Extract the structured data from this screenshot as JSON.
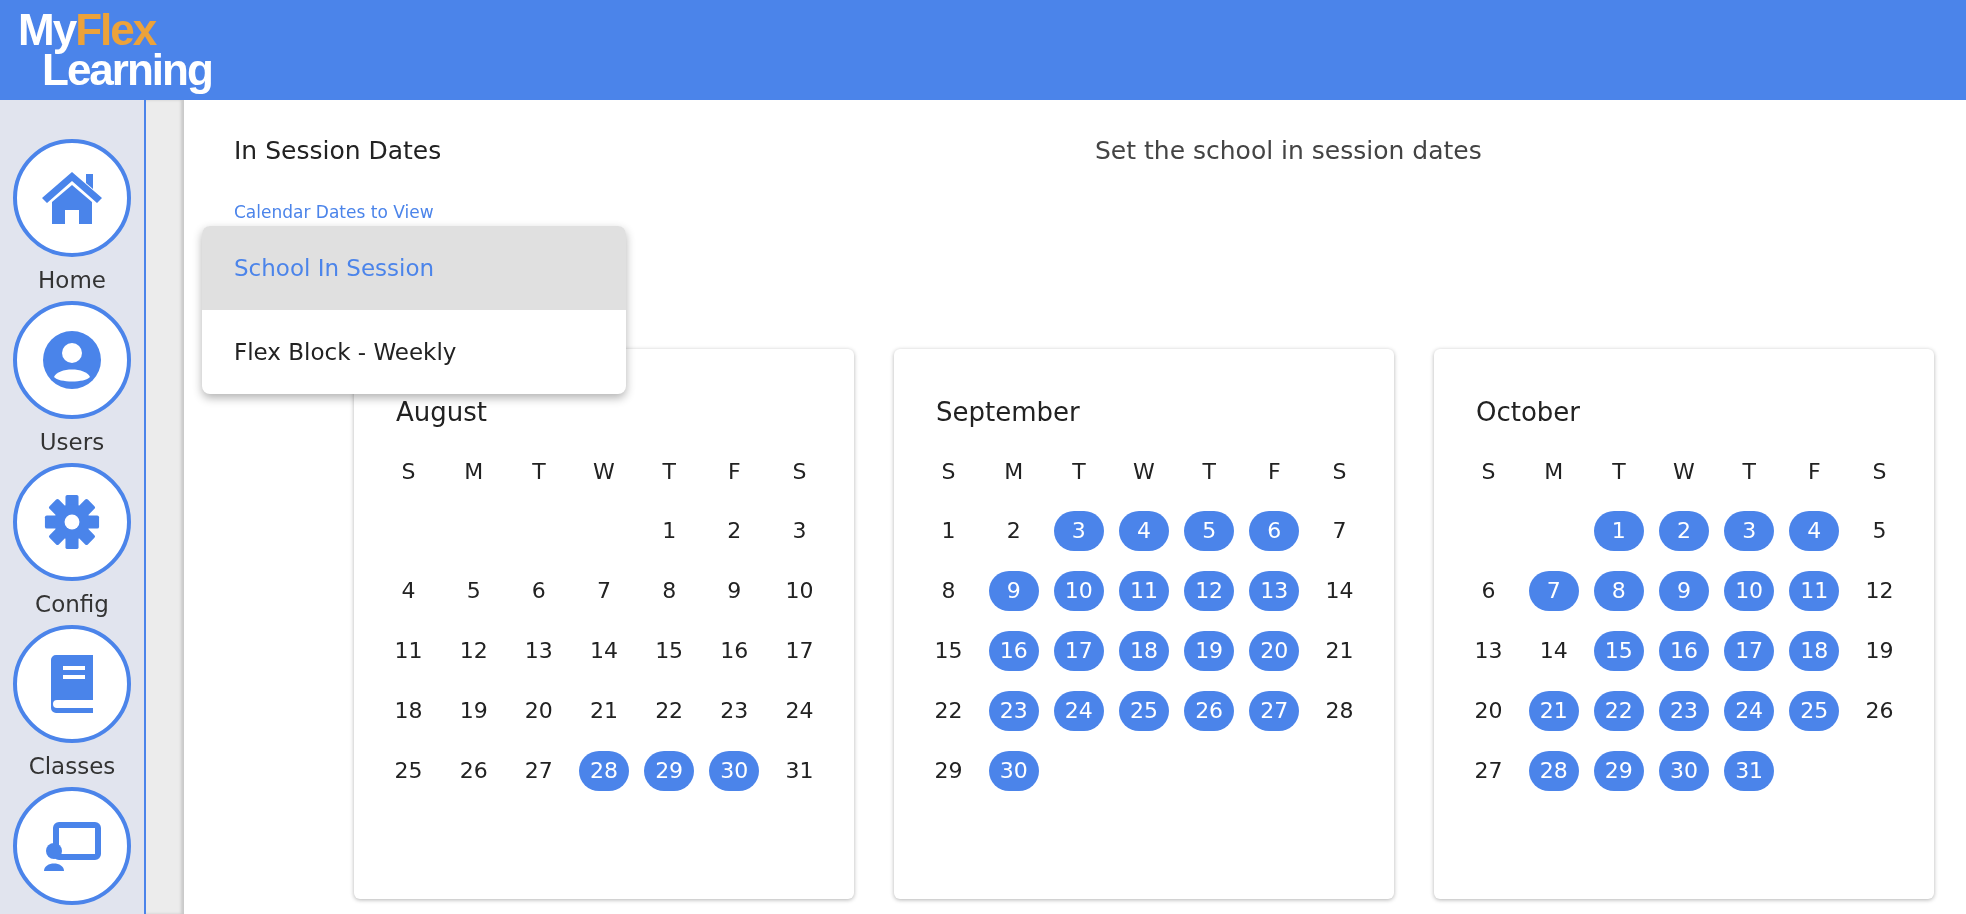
{
  "header": {
    "logo": {
      "top_left": "My",
      "top_right": "Flex",
      "bottom": "Learning"
    }
  },
  "sidebar": {
    "items": [
      {
        "label": "Home"
      },
      {
        "label": "Users"
      },
      {
        "label": "Config"
      },
      {
        "label": "Classes"
      }
    ]
  },
  "page": {
    "title": "In Session Dates",
    "subtitle": "Set the school in session dates"
  },
  "field": {
    "label": "Calendar Dates to View"
  },
  "menu": {
    "options": [
      {
        "label": "School In Session",
        "selected": true
      },
      {
        "label": "Flex Block - Weekly",
        "selected": false
      }
    ]
  },
  "calendars": [
    {
      "month": "August",
      "weekdays": [
        "S",
        "M",
        "T",
        "W",
        "T",
        "F",
        "S"
      ],
      "weeks": [
        [
          {
            "day": "1",
            "selected": false
          },
          {
            "day": "2",
            "selected": false
          },
          {
            "day": "3",
            "selected": false
          }
        ],
        [
          {
            "day": "4",
            "selected": false
          },
          {
            "day": "5",
            "selected": false
          },
          {
            "day": "6",
            "selected": false
          },
          {
            "day": "7",
            "selected": false
          },
          {
            "day": "8",
            "selected": false
          },
          {
            "day": "9",
            "selected": false
          },
          {
            "day": "10",
            "selected": false
          }
        ],
        [
          {
            "day": "11",
            "selected": false
          },
          {
            "day": "12",
            "selected": false
          },
          {
            "day": "13",
            "selected": false
          },
          {
            "day": "14",
            "selected": false
          },
          {
            "day": "15",
            "selected": false
          },
          {
            "day": "16",
            "selected": false
          },
          {
            "day": "17",
            "selected": false
          }
        ],
        [
          {
            "day": "18",
            "selected": false
          },
          {
            "day": "19",
            "selected": false
          },
          {
            "day": "20",
            "selected": false
          },
          {
            "day": "21",
            "selected": false
          },
          {
            "day": "22",
            "selected": false
          },
          {
            "day": "23",
            "selected": false
          },
          {
            "day": "24",
            "selected": false
          }
        ],
        [
          {
            "day": "25",
            "selected": false
          },
          {
            "day": "26",
            "selected": false
          },
          {
            "day": "27",
            "selected": false
          },
          {
            "day": "28",
            "selected": true
          },
          {
            "day": "29",
            "selected": true
          },
          {
            "day": "30",
            "selected": true
          },
          {
            "day": "31",
            "selected": false
          }
        ]
      ]
    },
    {
      "month": "September",
      "weekdays": [
        "S",
        "M",
        "T",
        "W",
        "T",
        "F",
        "S"
      ],
      "weeks": [
        [
          {
            "day": "1",
            "selected": false
          },
          {
            "day": "2",
            "selected": false
          },
          {
            "day": "3",
            "selected": true
          },
          {
            "day": "4",
            "selected": true
          },
          {
            "day": "5",
            "selected": true
          },
          {
            "day": "6",
            "selected": true
          },
          {
            "day": "7",
            "selected": false
          }
        ],
        [
          {
            "day": "8",
            "selected": false
          },
          {
            "day": "9",
            "selected": true
          },
          {
            "day": "10",
            "selected": true
          },
          {
            "day": "11",
            "selected": true
          },
          {
            "day": "12",
            "selected": true
          },
          {
            "day": "13",
            "selected": true
          },
          {
            "day": "14",
            "selected": false
          }
        ],
        [
          {
            "day": "15",
            "selected": false
          },
          {
            "day": "16",
            "selected": true
          },
          {
            "day": "17",
            "selected": true
          },
          {
            "day": "18",
            "selected": true
          },
          {
            "day": "19",
            "selected": true
          },
          {
            "day": "20",
            "selected": true
          },
          {
            "day": "21",
            "selected": false
          }
        ],
        [
          {
            "day": "22",
            "selected": false
          },
          {
            "day": "23",
            "selected": true
          },
          {
            "day": "24",
            "selected": true
          },
          {
            "day": "25",
            "selected": true
          },
          {
            "day": "26",
            "selected": true
          },
          {
            "day": "27",
            "selected": true
          },
          {
            "day": "28",
            "selected": false
          }
        ],
        [
          {
            "day": "29",
            "selected": false
          },
          {
            "day": "30",
            "selected": true
          }
        ]
      ]
    },
    {
      "month": "October",
      "weekdays": [
        "S",
        "M",
        "T",
        "W",
        "T",
        "F",
        "S"
      ],
      "weeks": [
        [
          {
            "day": "1",
            "selected": true
          },
          {
            "day": "2",
            "selected": true
          },
          {
            "day": "3",
            "selected": true
          },
          {
            "day": "4",
            "selected": true
          },
          {
            "day": "5",
            "selected": false
          }
        ],
        [
          {
            "day": "6",
            "selected": false
          },
          {
            "day": "7",
            "selected": true
          },
          {
            "day": "8",
            "selected": true
          },
          {
            "day": "9",
            "selected": true
          },
          {
            "day": "10",
            "selected": true
          },
          {
            "day": "11",
            "selected": true
          },
          {
            "day": "12",
            "selected": false
          }
        ],
        [
          {
            "day": "13",
            "selected": false
          },
          {
            "day": "14",
            "selected": false
          },
          {
            "day": "15",
            "selected": true
          },
          {
            "day": "16",
            "selected": true
          },
          {
            "day": "17",
            "selected": true
          },
          {
            "day": "18",
            "selected": true
          },
          {
            "day": "19",
            "selected": false
          }
        ],
        [
          {
            "day": "20",
            "selected": false
          },
          {
            "day": "21",
            "selected": true
          },
          {
            "day": "22",
            "selected": true
          },
          {
            "day": "23",
            "selected": true
          },
          {
            "day": "24",
            "selected": true
          },
          {
            "day": "25",
            "selected": true
          },
          {
            "day": "26",
            "selected": false
          }
        ],
        [
          {
            "day": "27",
            "selected": false
          },
          {
            "day": "28",
            "selected": true
          },
          {
            "day": "29",
            "selected": true
          },
          {
            "day": "30",
            "selected": true
          },
          {
            "day": "31",
            "selected": true
          }
        ]
      ]
    }
  ]
}
